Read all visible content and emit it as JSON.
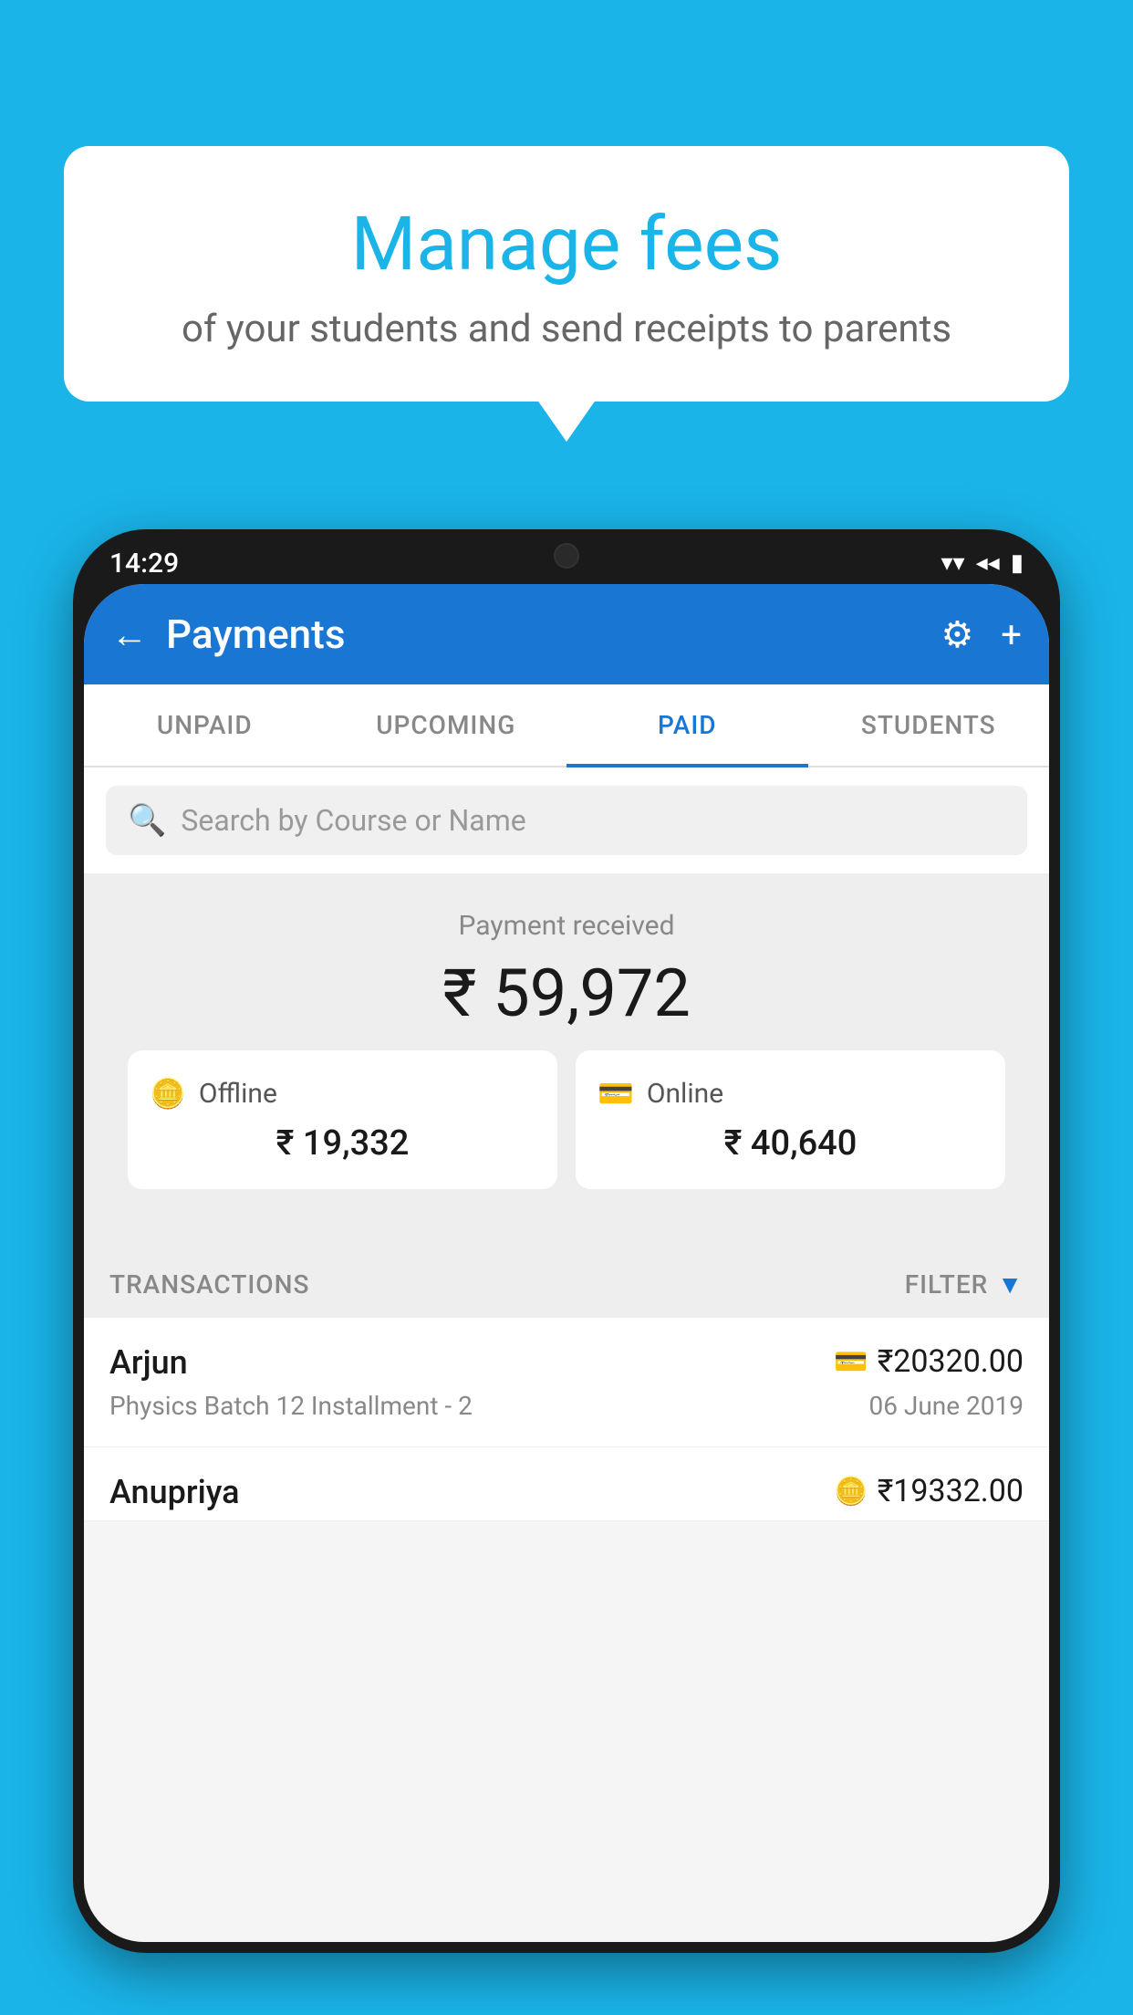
{
  "background_color": "#1ab4e8",
  "speech_bubble": {
    "title": "Manage fees",
    "subtitle": "of your students and send receipts to parents"
  },
  "status_bar": {
    "time": "14:29",
    "wifi": "▼",
    "signal": "▲",
    "battery": "▌"
  },
  "app_bar": {
    "title": "Payments",
    "back_label": "←",
    "settings_label": "⚙",
    "add_label": "+"
  },
  "tabs": [
    {
      "id": "unpaid",
      "label": "UNPAID",
      "active": false
    },
    {
      "id": "upcoming",
      "label": "UPCOMING",
      "active": false
    },
    {
      "id": "paid",
      "label": "PAID",
      "active": true
    },
    {
      "id": "students",
      "label": "STUDENTS",
      "active": false
    }
  ],
  "search": {
    "placeholder": "Search by Course or Name"
  },
  "payment_summary": {
    "label": "Payment received",
    "amount": "₹ 59,972"
  },
  "cards": [
    {
      "id": "offline",
      "label": "Offline",
      "amount": "₹ 19,332",
      "icon": "offline"
    },
    {
      "id": "online",
      "label": "Online",
      "amount": "₹ 40,640",
      "icon": "online"
    }
  ],
  "transactions": {
    "header_label": "TRANSACTIONS",
    "filter_label": "FILTER",
    "items": [
      {
        "name": "Arjun",
        "course": "Physics Batch 12 Installment - 2",
        "amount": "₹20320.00",
        "date": "06 June 2019",
        "payment_type": "online"
      },
      {
        "name": "Anupriya",
        "course": "",
        "amount": "₹19332.00",
        "date": "",
        "payment_type": "offline"
      }
    ]
  }
}
